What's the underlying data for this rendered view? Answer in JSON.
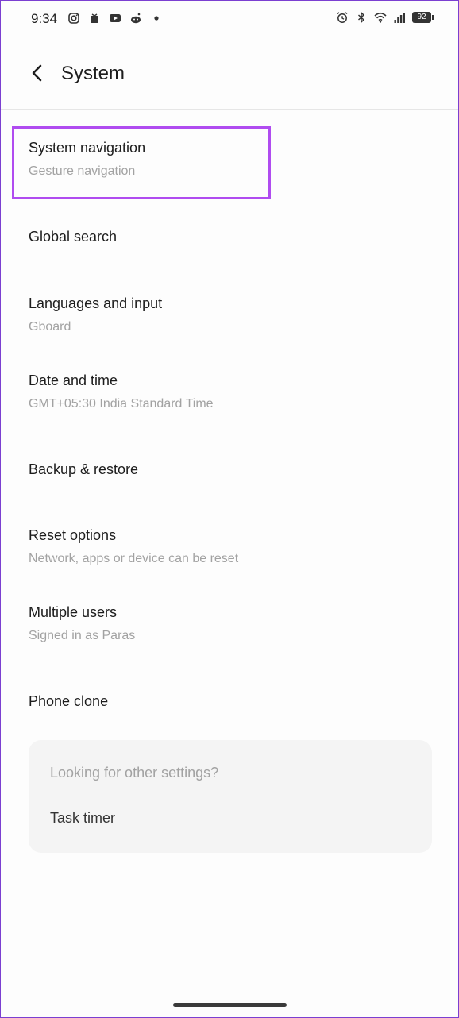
{
  "status_bar": {
    "time": "9:34",
    "left_icons": [
      "instagram-icon",
      "notification-icon",
      "youtube-icon",
      "reddit-icon",
      "dot-icon"
    ],
    "right_icons": [
      "alarm-icon",
      "bluetooth-icon",
      "wifi-icon",
      "signal-icon"
    ],
    "battery": "92"
  },
  "header": {
    "title": "System",
    "back_icon": "chevron-left-icon"
  },
  "settings": {
    "items": [
      {
        "title": "System navigation",
        "subtitle": "Gesture navigation"
      },
      {
        "title": "Global search",
        "subtitle": ""
      },
      {
        "title": "Languages and input",
        "subtitle": "Gboard"
      },
      {
        "title": "Date and time",
        "subtitle": "GMT+05:30 India Standard Time"
      },
      {
        "title": "Backup & restore",
        "subtitle": ""
      },
      {
        "title": "Reset options",
        "subtitle": "Network, apps or device can be reset"
      },
      {
        "title": "Multiple users",
        "subtitle": "Signed in as Paras"
      },
      {
        "title": "Phone clone",
        "subtitle": ""
      }
    ]
  },
  "suggestions": {
    "header": "Looking for other settings?",
    "link": "Task timer"
  },
  "colors": {
    "highlight": "#b04cf0",
    "subtitle": "#a2a2a2",
    "card_bg": "#f4f4f4"
  }
}
